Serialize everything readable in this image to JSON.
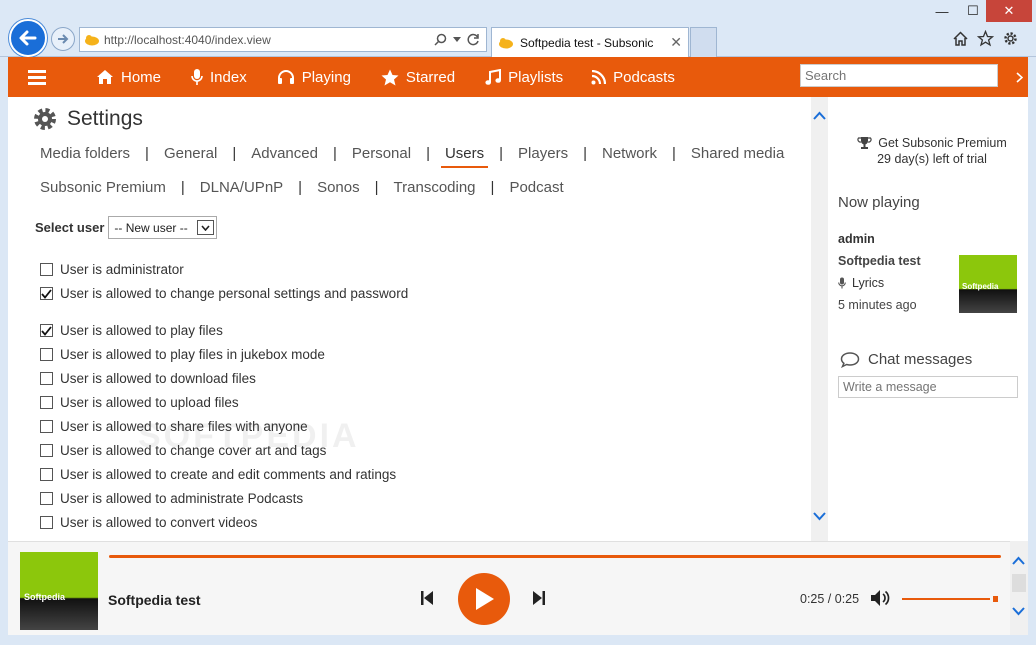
{
  "browser": {
    "address": "http://localhost:4040/index.view",
    "tab_title": "Softpedia test - Subsonic",
    "tab_close": "✕",
    "win_min": "—",
    "win_max": "☐",
    "win_close": "✕"
  },
  "topbar": {
    "nav": [
      {
        "label": "Home",
        "icon": "home-icon"
      },
      {
        "label": "Index",
        "icon": "microphone-icon"
      },
      {
        "label": "Playing",
        "icon": "headphones-icon"
      },
      {
        "label": "Starred",
        "icon": "star-icon"
      },
      {
        "label": "Playlists",
        "icon": "music-icon"
      },
      {
        "label": "Podcasts",
        "icon": "rss-icon"
      }
    ],
    "search_placeholder": "Search"
  },
  "settings": {
    "title": "Settings",
    "tabs_row1": [
      "Media folders",
      "General",
      "Advanced",
      "Personal",
      "Users",
      "Players",
      "Network",
      "Shared media"
    ],
    "tabs_row2": [
      "Subsonic Premium",
      "DLNA/UPnP",
      "Sonos",
      "Transcoding",
      "Podcast"
    ],
    "active_tab": "Users",
    "select_label": "Select user",
    "select_value": "-- New user --",
    "permissions": [
      {
        "label": "User is administrator",
        "checked": false
      },
      {
        "label": "User is allowed to change personal settings and password",
        "checked": true
      },
      {
        "label": "User is allowed to play files",
        "checked": true
      },
      {
        "label": "User is allowed to play files in jukebox mode",
        "checked": false
      },
      {
        "label": "User is allowed to download files",
        "checked": false
      },
      {
        "label": "User is allowed to upload files",
        "checked": false
      },
      {
        "label": "User is allowed to share files with anyone",
        "checked": false
      },
      {
        "label": "User is allowed to change cover art and tags",
        "checked": false
      },
      {
        "label": "User is allowed to create and edit comments and ratings",
        "checked": false
      },
      {
        "label": "User is allowed to administrate Podcasts",
        "checked": false
      },
      {
        "label": "User is allowed to convert videos",
        "checked": false
      }
    ],
    "watermark": "SOFTPEDIA"
  },
  "right": {
    "premium_line1": "Get Subsonic Premium",
    "premium_line2": "29 day(s) left of trial",
    "now_playing_title": "Now playing",
    "user": "admin",
    "song": "Softpedia test",
    "lyrics": "Lyrics",
    "time_ago": "5 minutes ago",
    "cover_label": "Softpedia",
    "chat_title": "Chat messages",
    "chat_placeholder": "Write a message"
  },
  "player": {
    "title": "Softpedia test",
    "cover_label": "Softpedia",
    "time": "0:25 / 0:25",
    "progress": 1.0,
    "volume": 0.97
  },
  "colors": {
    "accent": "#e85a0c",
    "cover_green": "#8cc70c"
  }
}
